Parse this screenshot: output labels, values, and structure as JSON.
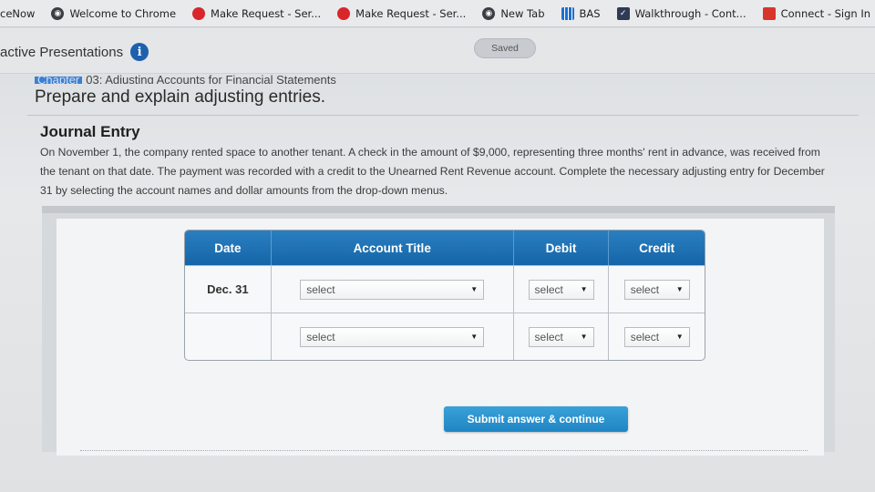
{
  "bookmarks": [
    {
      "label": "ceNow",
      "icon": "none"
    },
    {
      "label": "Welcome to Chrome",
      "icon": "globe-icon"
    },
    {
      "label": "Make Request - Ser...",
      "icon": "red-dot-icon"
    },
    {
      "label": "Make Request - Ser...",
      "icon": "red-dot-icon"
    },
    {
      "label": "New Tab",
      "icon": "globe-icon"
    },
    {
      "label": "BAS",
      "icon": "grid-icon"
    },
    {
      "label": "Walkthrough - Cont...",
      "icon": "checkmark-icon"
    },
    {
      "label": "Connect - Sign In",
      "icon": "connect-icon"
    }
  ],
  "header": {
    "section_title": "active Presentations",
    "info_glyph": "i",
    "saved_label": "Saved"
  },
  "chapter": {
    "tag": "Chapter",
    "rest": "03: Adjusting Accounts for Financial Statements"
  },
  "objective": "Prepare and explain adjusting entries.",
  "journal": {
    "title": "Journal Entry",
    "description": "On November 1, the company rented space to another tenant. A check in the amount of $9,000, representing three months' rent in advance, was received from the tenant on that date. The payment was recorded with a credit to the Unearned Rent Revenue account. Complete the necessary adjusting entry for December 31 by selecting the account names and dollar amounts from the drop-down menus."
  },
  "table": {
    "headers": {
      "date": "Date",
      "account": "Account Title",
      "debit": "Debit",
      "credit": "Credit"
    },
    "rows": [
      {
        "date": "Dec. 31",
        "account": "select",
        "debit": "select",
        "credit": "select"
      },
      {
        "date": "",
        "account": "select",
        "debit": "select",
        "credit": "select"
      }
    ]
  },
  "submit_label": "Submit answer & continue",
  "colors": {
    "table_header": "#1a6fb2",
    "submit": "#2a90cc",
    "info_icon": "#1e5fae"
  }
}
